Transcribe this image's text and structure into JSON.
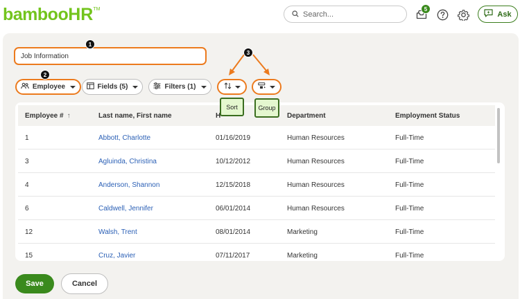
{
  "header": {
    "logo_main": "bamboo",
    "logo_suffix": "HR",
    "logo_tm": "TM",
    "search_placeholder": "Search...",
    "inbox_badge": "5",
    "ask_label": "Ask"
  },
  "report": {
    "name": "Job Information"
  },
  "toolbar": {
    "employee_label": "Employee",
    "fields_label": "Fields (5)",
    "filters_label": "Filters (1)"
  },
  "annotations": {
    "marker_1": "1",
    "marker_2": "2",
    "marker_3": "3",
    "sort_tooltip": "Sort",
    "group_tooltip": "Group",
    "accent_color": "#ec7a1d",
    "tooltip_bg": "#e4f7cf"
  },
  "table": {
    "columns": [
      "Employee #",
      "Last name, First name",
      "H",
      "Department",
      "Employment Status"
    ],
    "sort_indicator": "↑",
    "rows": [
      [
        "1",
        "Abbott, Charlotte",
        "01/16/2019",
        "Human Resources",
        "Full-Time"
      ],
      [
        "3",
        "Agluinda, Christina",
        "10/12/2012",
        "Human Resources",
        "Full-Time"
      ],
      [
        "4",
        "Anderson, Shannon",
        "12/15/2018",
        "Human Resources",
        "Full-Time"
      ],
      [
        "6",
        "Caldwell, Jennifer",
        "06/01/2014",
        "Human Resources",
        "Full-Time"
      ],
      [
        "12",
        "Walsh, Trent",
        "08/01/2014",
        "Marketing",
        "Full-Time"
      ],
      [
        "15",
        "Cruz, Javier",
        "07/11/2017",
        "Marketing",
        "Full-Time"
      ]
    ]
  },
  "footer": {
    "save_label": "Save",
    "cancel_label": "Cancel"
  },
  "colors": {
    "brand_green": "#73c41d",
    "button_green": "#3a8a1d",
    "link_blue": "#2a5fb5"
  }
}
